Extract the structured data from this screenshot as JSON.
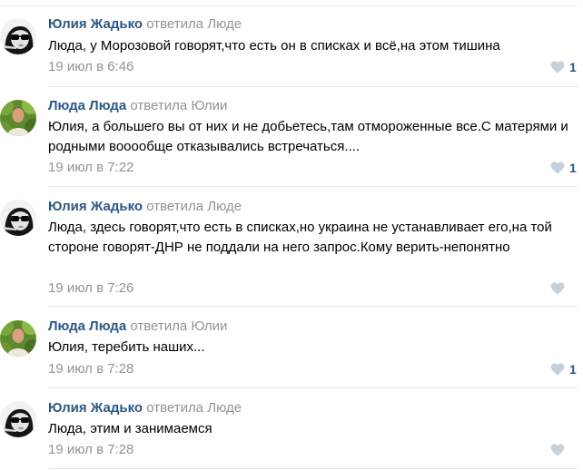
{
  "comments": [
    {
      "author": "Юлия Жадько",
      "replied": "ответила Люде",
      "text": "Люда, у Морозовой говорят,что есть он в списках и всё,на этом тишина",
      "date": "19 июл в 6:46",
      "likes": "1",
      "avatar_icon": "avatar-woman-sunglasses-icon"
    },
    {
      "author": "Люда Люда",
      "replied": "ответила Юлии",
      "text": "Юлия, а большего вы от них и не добьетесь,там отмороженные все.С матерями и родными вооообще отказывались встречаться....",
      "date": "19 июл в 7:22",
      "likes": "1",
      "avatar_icon": "avatar-woman-outdoors-icon"
    },
    {
      "author": "Юлия Жадько",
      "replied": "ответила Люде",
      "text": "Люда, здесь говорят,что есть в списках,но украина не устанавливает его,на той стороне говорят-ДНР не поддали на него запрос.Кому верить-непонятно",
      "date": "19 июл в 7:26",
      "likes": "",
      "avatar_icon": "avatar-woman-sunglasses-icon"
    },
    {
      "author": "Люда Люда",
      "replied": "ответила Юлии",
      "text": "Юлия, теребить наших...",
      "date": "19 июл в 7:28",
      "likes": "1",
      "avatar_icon": "avatar-woman-outdoors-icon"
    },
    {
      "author": "Юлия Жадько",
      "replied": "ответила Люде",
      "text": "Люда, этим и занимаемся",
      "date": "19 июл в 7:28",
      "likes": "",
      "avatar_icon": "avatar-woman-sunglasses-icon"
    }
  ],
  "colors": {
    "author": "#2a5885",
    "meta": "#939393",
    "divider": "#e7e8ec",
    "heart": "#c5d0db"
  }
}
